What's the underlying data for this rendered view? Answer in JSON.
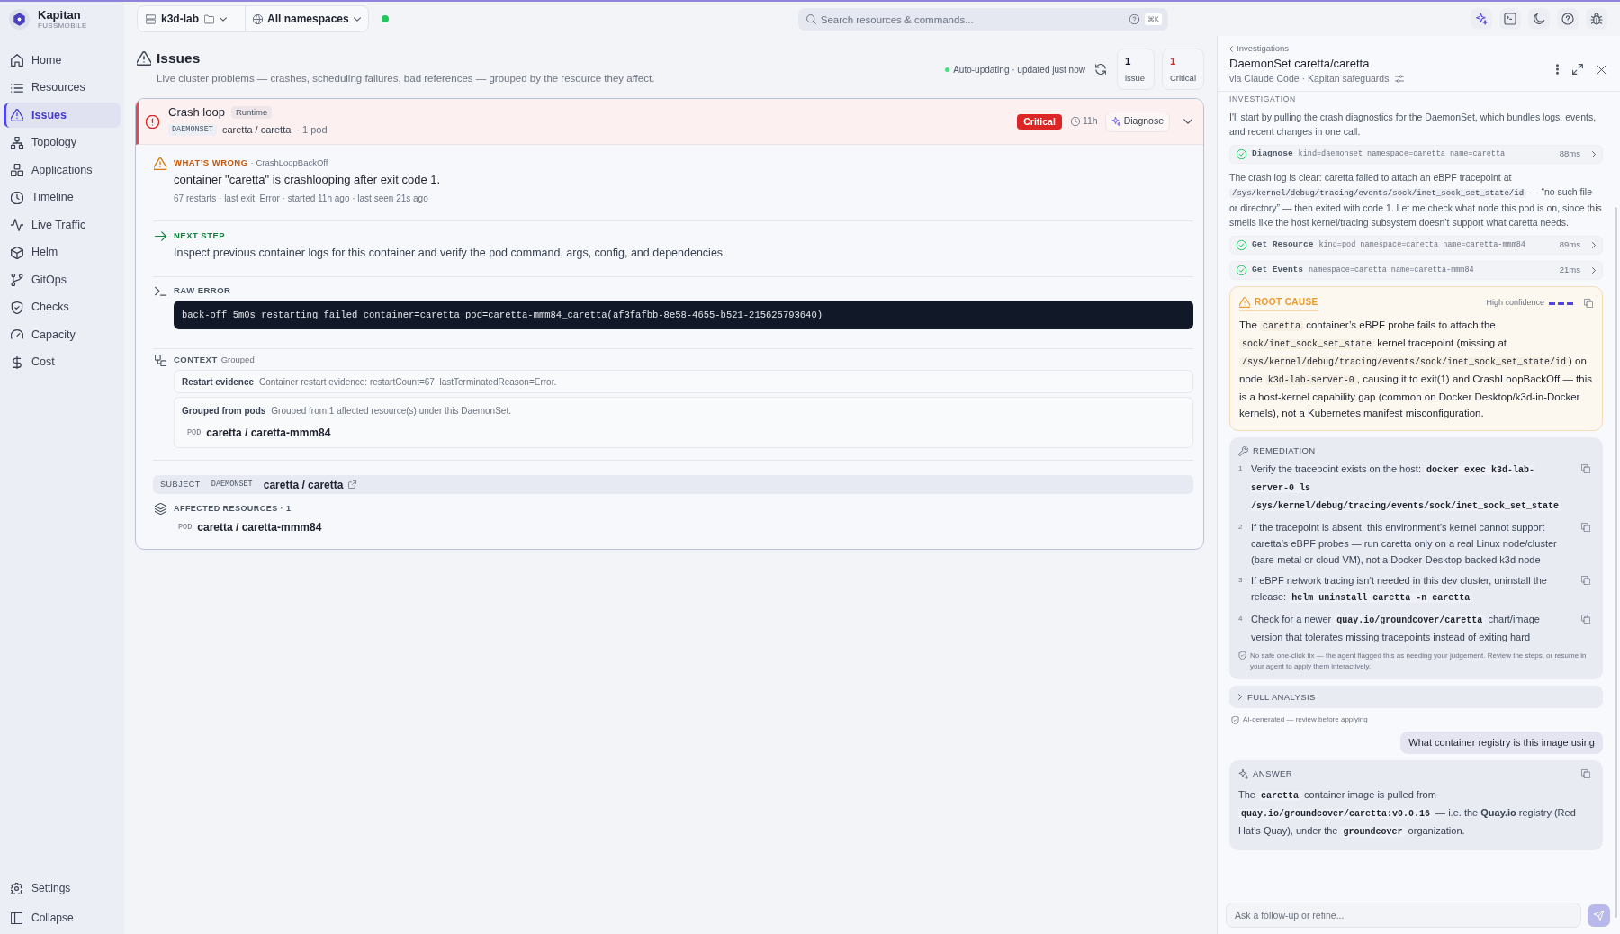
{
  "app": {
    "name": "Kapitan",
    "org": "FUSSMOBILE"
  },
  "sidebar": {
    "items": [
      {
        "label": "Home",
        "selected": false
      },
      {
        "label": "Resources",
        "selected": false
      },
      {
        "label": "Issues",
        "selected": true
      },
      {
        "label": "Topology",
        "selected": false
      },
      {
        "label": "Applications",
        "selected": false
      },
      {
        "label": "Timeline",
        "selected": false
      },
      {
        "label": "Live Traffic",
        "selected": false
      },
      {
        "label": "Helm",
        "selected": false
      },
      {
        "label": "GitOps",
        "selected": false
      },
      {
        "label": "Checks",
        "selected": false
      },
      {
        "label": "Capacity",
        "selected": false
      },
      {
        "label": "Cost",
        "selected": false
      }
    ],
    "footer": [
      {
        "label": "Settings"
      },
      {
        "label": "Collapse"
      }
    ]
  },
  "topbar": {
    "cluster": "k3d-lab",
    "namespace": "All namespaces",
    "connected": true,
    "search": {
      "placeholder": "Search resources & commands...",
      "shortcut": "⌘K"
    }
  },
  "page": {
    "title": "Issues",
    "subtitle": "Live cluster problems — crashes, scheduling failures, bad references — grouped by the resource they affect.",
    "auto_update": "Auto-updating · updated just now",
    "live": true,
    "stats": [
      {
        "value": "1",
        "label": "issue",
        "kind": "total"
      },
      {
        "value": "1",
        "label": "Critical",
        "kind": "critical"
      }
    ]
  },
  "issue": {
    "title": "Crash loop",
    "category": "Runtime",
    "resource_type": "DAEMONSET",
    "resource": "caretta / caretta",
    "pods": "· 1 pod",
    "severity": "Critical",
    "age": "11h",
    "action": "Diagnose",
    "expanded": true,
    "whats_wrong": {
      "label": "WHAT’S WRONG",
      "reason": "· CrashLoopBackOff",
      "summary": "container \"caretta\" is crashlooping after exit code 1.",
      "meta": "67 restarts · last exit: Error · started 11h ago · last seen 21s ago"
    },
    "next_step": {
      "label": "NEXT STEP",
      "text": "Inspect previous container logs for this container and verify the pod command, args, config, and dependencies."
    },
    "raw_error": {
      "label": "RAW ERROR",
      "text": "back-off 5m0s restarting failed container=caretta pod=caretta-mmm84_caretta(af3fafbb-8e58-4655-b521-215625793640)"
    },
    "context": {
      "label": "CONTEXT",
      "tag": "Grouped",
      "items": [
        {
          "title": "Restart evidence",
          "text": "Container restart evidence: restartCount=67, lastTerminatedReason=Error."
        },
        {
          "title": "Grouped from pods",
          "text": "Grouped from 1 affected resource(s) under this DaemonSet.",
          "pods": [
            {
              "type": "POD",
              "name": "caretta / caretta-mmm84"
            }
          ]
        }
      ]
    },
    "subject": {
      "label": "SUBJECT",
      "type": "DAEMONSET",
      "name": "caretta / caretta"
    },
    "affected": {
      "label": "AFFECTED RESOURCES · 1",
      "items": [
        {
          "type": "POD",
          "name": "caretta / caretta-mmm84"
        }
      ]
    }
  },
  "panel": {
    "back": "Investigations",
    "title": "DaemonSet caretta/caretta",
    "via": "via Claude Code · Kapitan safeguards",
    "section": "INVESTIGATION",
    "feed": [
      {
        "kind": "text",
        "segments": [
          {
            "kind": "text",
            "text": "I'll start by pulling the crash diagnostics for the DaemonSet, which bundles logs, events, and recent changes in one call."
          }
        ]
      },
      {
        "kind": "tool",
        "name": "Diagnose",
        "args": "kind=daemonset namespace=caretta name=caretta",
        "duration": "88ms",
        "succeeded": true
      },
      {
        "kind": "text",
        "segments": [
          {
            "kind": "text",
            "text": "The crash log is clear: caretta failed to attach an eBPF tracepoint at "
          },
          {
            "kind": "code",
            "text": "/sys/kernel/debug/tracing/events/sock/inet_sock_set_state/id"
          },
          {
            "kind": "text",
            "text": " — “no such file or directory” — then exited with code 1. Let me check what node this pod is on, since this smells like the host kernel/tracing subsystem doesn’t support what caretta needs."
          }
        ]
      },
      {
        "kind": "tool",
        "name": "Get Resource",
        "args": "kind=pod namespace=caretta name=caretta-mmm84",
        "duration": "89ms",
        "succeeded": true
      },
      {
        "kind": "tool",
        "name": "Get Events",
        "args": "namespace=caretta name=caretta-mmm84",
        "duration": "21ms",
        "succeeded": true
      }
    ],
    "root_cause": {
      "label": "ROOT CAUSE",
      "confidence": "High confidence",
      "confidence_meter": {
        "level": 1
      },
      "segments": [
        {
          "kind": "text",
          "text": "The "
        },
        {
          "kind": "code",
          "text": "caretta"
        },
        {
          "kind": "text",
          "text": " container’s eBPF probe fails to attach the "
        },
        {
          "kind": "code",
          "text": "sock/inet_sock_set_state"
        },
        {
          "kind": "text",
          "text": " kernel tracepoint (missing at "
        },
        {
          "kind": "code",
          "text": "/sys/kernel/debug/tracing/events/sock/inet_sock_set_state/id"
        },
        {
          "kind": "text",
          "text": ") on node "
        },
        {
          "kind": "code",
          "text": "k3d-lab-server-0"
        },
        {
          "kind": "text",
          "text": ", causing it to exit(1) and CrashLoopBackOff — this is a host-kernel capability gap (common on Docker Desktop/k3d-in-Docker kernels), not a Kubernetes manifest misconfiguration."
        }
      ]
    },
    "remediation": {
      "label": "REMEDIATION",
      "steps": [
        {
          "number": "1",
          "segments": [
            {
              "kind": "text",
              "text": "Verify the tracepoint exists on the host: "
            },
            {
              "kind": "code",
              "text": "docker exec k3d-lab-server-0 ls /sys/kernel/debug/tracing/events/sock/inet_sock_set_state"
            }
          ]
        },
        {
          "number": "2",
          "segments": [
            {
              "kind": "text",
              "text": "If the tracepoint is absent, this environment’s kernel cannot support caretta’s eBPF probes — run caretta only on a real Linux node/cluster (bare-metal or cloud VM), not a Docker-Desktop-backed k3d node"
            }
          ]
        },
        {
          "number": "3",
          "segments": [
            {
              "kind": "text",
              "text": "If eBPF network tracing isn’t needed in this dev cluster, uninstall the release: "
            },
            {
              "kind": "code",
              "text": "helm uninstall caretta -n caretta"
            }
          ]
        },
        {
          "number": "4",
          "segments": [
            {
              "kind": "text",
              "text": "Check for a newer "
            },
            {
              "kind": "code",
              "text": "quay.io/groundcover/caretta"
            },
            {
              "kind": "text",
              "text": " chart/image version that tolerates missing tracepoints instead of exiting hard"
            }
          ]
        }
      ],
      "note": "No safe one-click fix — the agent flagged this as needing your judgement. Review the steps, or resume in your agent to apply them interactively."
    },
    "full_analysis": {
      "label": "FULL ANALYSIS",
      "expanded": false
    },
    "disclaimer": "AI-generated — review before applying",
    "user_message": "What container registry is this image using",
    "answer": {
      "label": "ANSWER",
      "segments": [
        {
          "kind": "text",
          "text": "The "
        },
        {
          "kind": "code",
          "text": "caretta"
        },
        {
          "kind": "text",
          "text": " container image is pulled from "
        },
        {
          "kind": "code",
          "text": "quay.io/groundcover/caretta:v0.0.16"
        },
        {
          "kind": "text",
          "text": " — i.e. the **Quay.io** registry (Red Hat’s Quay), under the "
        },
        {
          "kind": "code",
          "text": "groundcover"
        },
        {
          "kind": "text",
          "text": " organization."
        }
      ]
    },
    "composer": {
      "placeholder": "Ask a follow-up or refine..."
    }
  }
}
